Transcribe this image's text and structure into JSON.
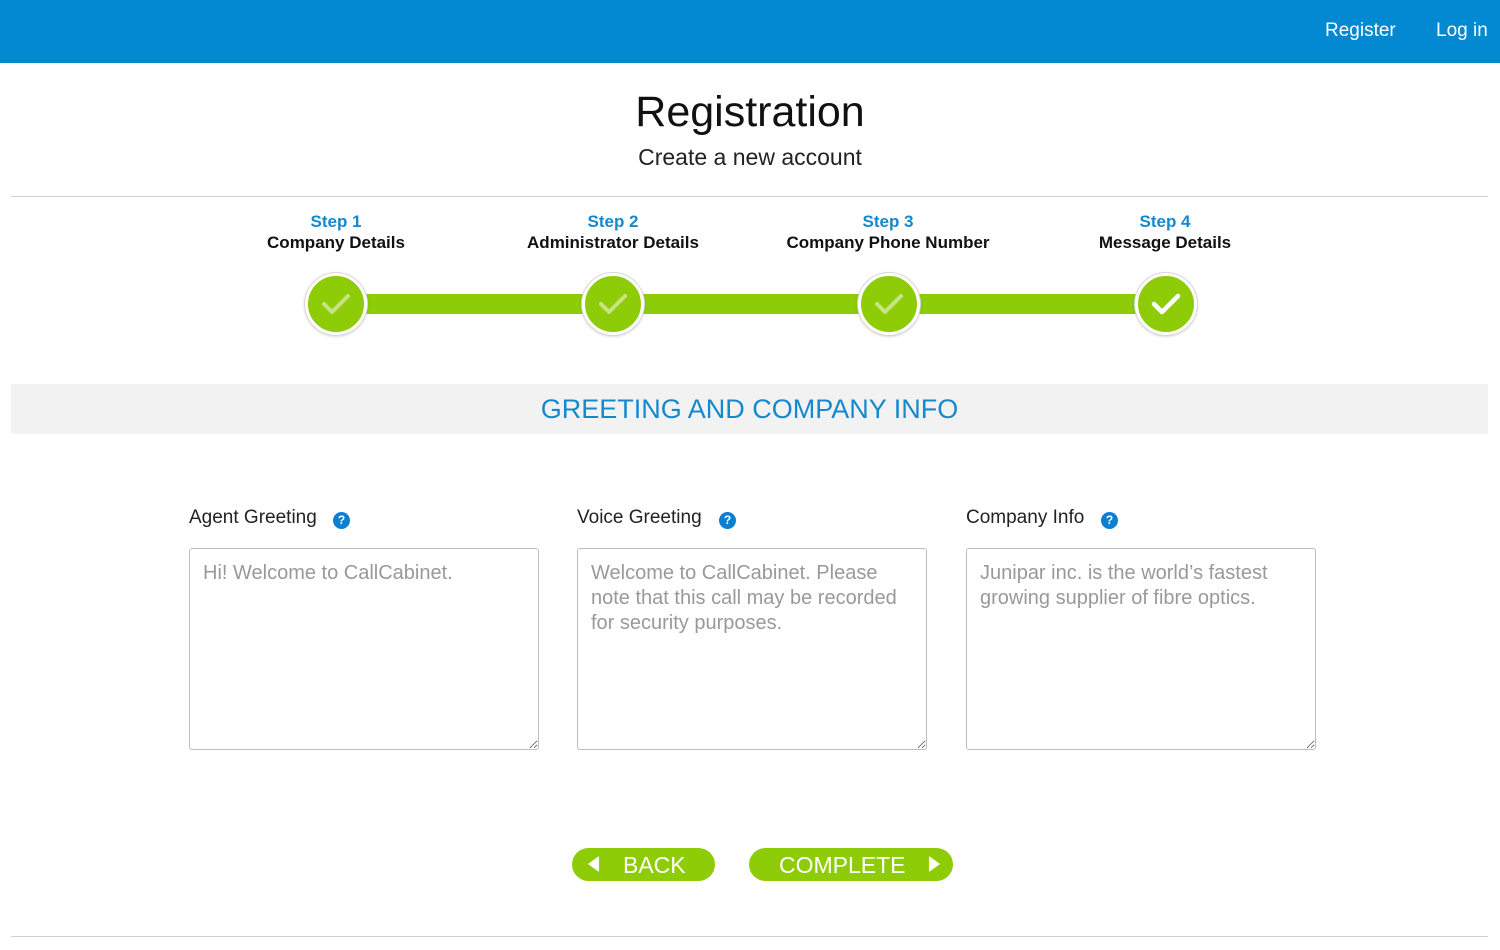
{
  "nav": {
    "register": "Register",
    "login": "Log in"
  },
  "header": {
    "title": "Registration",
    "subtitle": "Create a new account"
  },
  "steps": [
    {
      "number": "Step 1",
      "name": "Company Details",
      "completed": true
    },
    {
      "number": "Step 2",
      "name": "Administrator Details",
      "completed": true
    },
    {
      "number": "Step 3",
      "name": "Company Phone Number",
      "completed": true
    },
    {
      "number": "Step 4",
      "name": "Message Details",
      "completed": true,
      "current": true
    }
  ],
  "section": {
    "title": "GREETING AND COMPANY INFO"
  },
  "fields": [
    {
      "label": "Agent Greeting",
      "help": "?",
      "placeholder": "Hi! Welcome to CallCabinet."
    },
    {
      "label": "Voice Greeting",
      "help": "?",
      "placeholder": "Welcome to CallCabinet. Please note that this call may be recorded for security purposes."
    },
    {
      "label": "Company Info",
      "help": "?",
      "placeholder": "Junipar inc. is the world’s fastest growing supplier of fibre optics."
    }
  ],
  "buttons": {
    "back": "BACK",
    "complete": "COMPLETE"
  },
  "colors": {
    "topbar": "#0289d1",
    "accent_green": "#8dcc06",
    "accent_blue": "#1589cf",
    "section_band": "#f2f2f2"
  },
  "icons": {
    "step_check": "check-icon",
    "help": "help-icon",
    "back_arrow": "caret-left-icon",
    "next_arrow": "caret-right-icon"
  }
}
